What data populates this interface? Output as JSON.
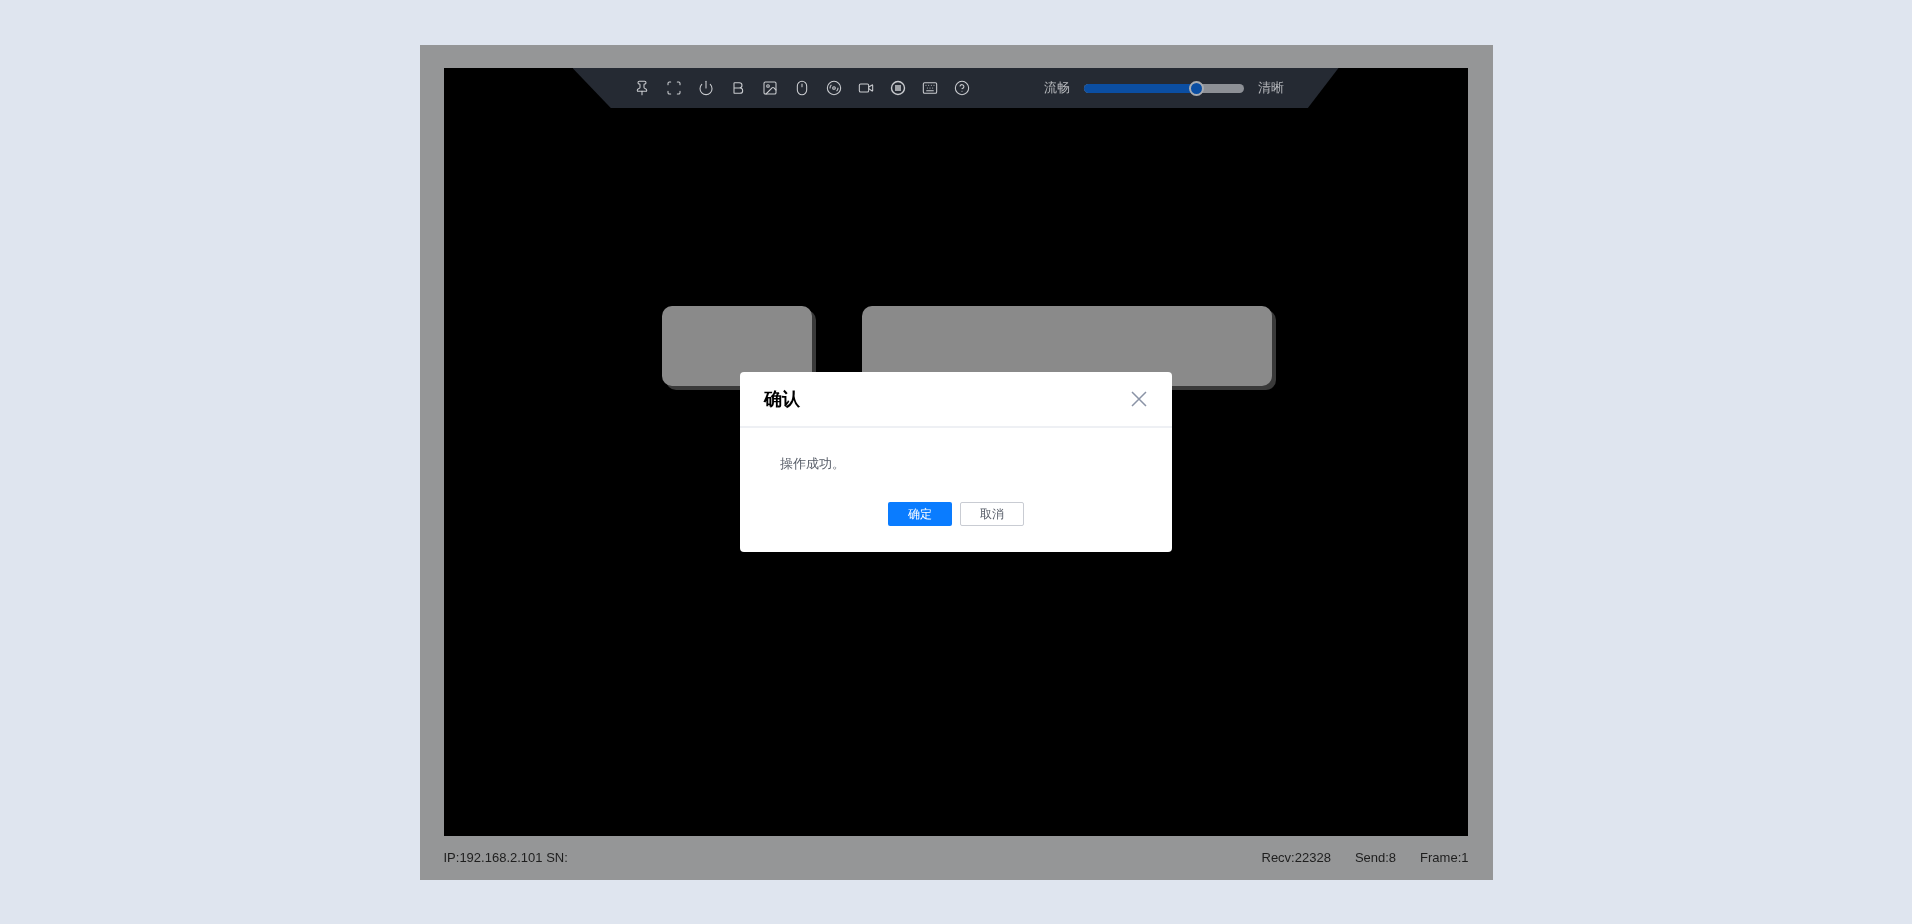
{
  "toolbar": {
    "quality": {
      "low_label": "流畅",
      "high_label": "清晰",
      "level": 0.7
    }
  },
  "dialog": {
    "title": "确认",
    "message": "操作成功。",
    "buttons": [
      {
        "label": "确定",
        "kind": "primary"
      },
      {
        "label": "取消",
        "kind": "secondary"
      }
    ]
  },
  "status_bar": {
    "left": [
      "IP:192.168.2.101 SN:"
    ],
    "right": [
      "Recv:22328",
      "Send:8",
      "Frame:1"
    ]
  }
}
